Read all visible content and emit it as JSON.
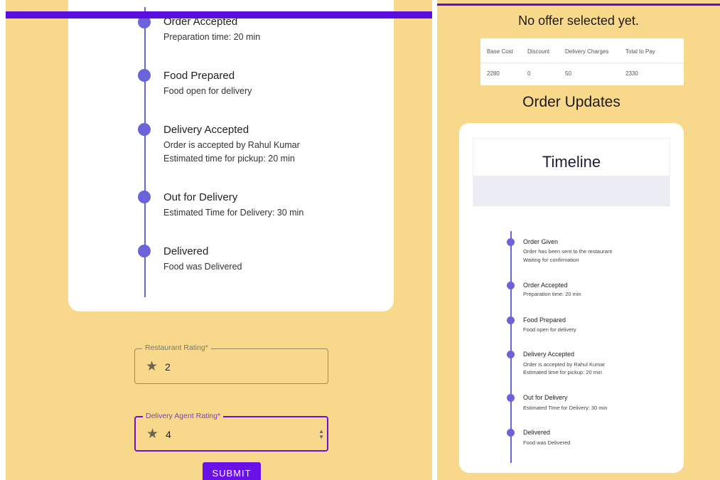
{
  "colors": {
    "background": "#f8d88a",
    "accent": "#5b0ee0",
    "timeline": "#6b63d9",
    "button": "#6a11e8"
  },
  "left": {
    "timeline": [
      {
        "title": "Order Accepted",
        "lines": [
          "Preparation time: 20 min"
        ]
      },
      {
        "title": "Food Prepared",
        "lines": [
          "Food open for delivery"
        ]
      },
      {
        "title": "Delivery Accepted",
        "lines": [
          "Order is accepted by Rahul Kumar",
          "Estimated time for pickup: 20 min"
        ]
      },
      {
        "title": "Out for Delivery",
        "lines": [
          "Estimated Time for Delivery: 30 min"
        ]
      },
      {
        "title": "Delivered",
        "lines": [
          "Food was Delivered"
        ]
      }
    ],
    "restaurant_rating": {
      "label": "Restaurant Rating*",
      "value": "2"
    },
    "agent_rating": {
      "label": "Delivery Agent Rating*",
      "value": "4"
    },
    "submit_label": "SUBMIT"
  },
  "right": {
    "offer_text": "No offer selected yet.",
    "table": {
      "headers": [
        "Base Cost",
        "Discount",
        "Delivery Charges",
        "Total to Pay"
      ],
      "row": [
        "2280",
        "0",
        "50",
        "2330"
      ]
    },
    "updates_title": "Order Updates",
    "timeline_heading": "Timeline",
    "timeline": [
      {
        "title": "Order Given",
        "lines": [
          "Order has been sent to the restaurant",
          "Waiting for confirmation"
        ]
      },
      {
        "title": "Order Accepted",
        "lines": [
          "Preparation time: 20 min"
        ]
      },
      {
        "title": "Food Prepared",
        "lines": [
          "Food open for delivery"
        ]
      },
      {
        "title": "Delivery Accepted",
        "lines": [
          "Order is accepted by Rahul Kumar",
          "Estimated time for pickup: 20 min"
        ]
      },
      {
        "title": "Out for Delivery",
        "lines": [
          "Estimated Time for Delivery: 30 min"
        ]
      },
      {
        "title": "Delivered",
        "lines": [
          "Food was Delivered"
        ]
      }
    ]
  }
}
